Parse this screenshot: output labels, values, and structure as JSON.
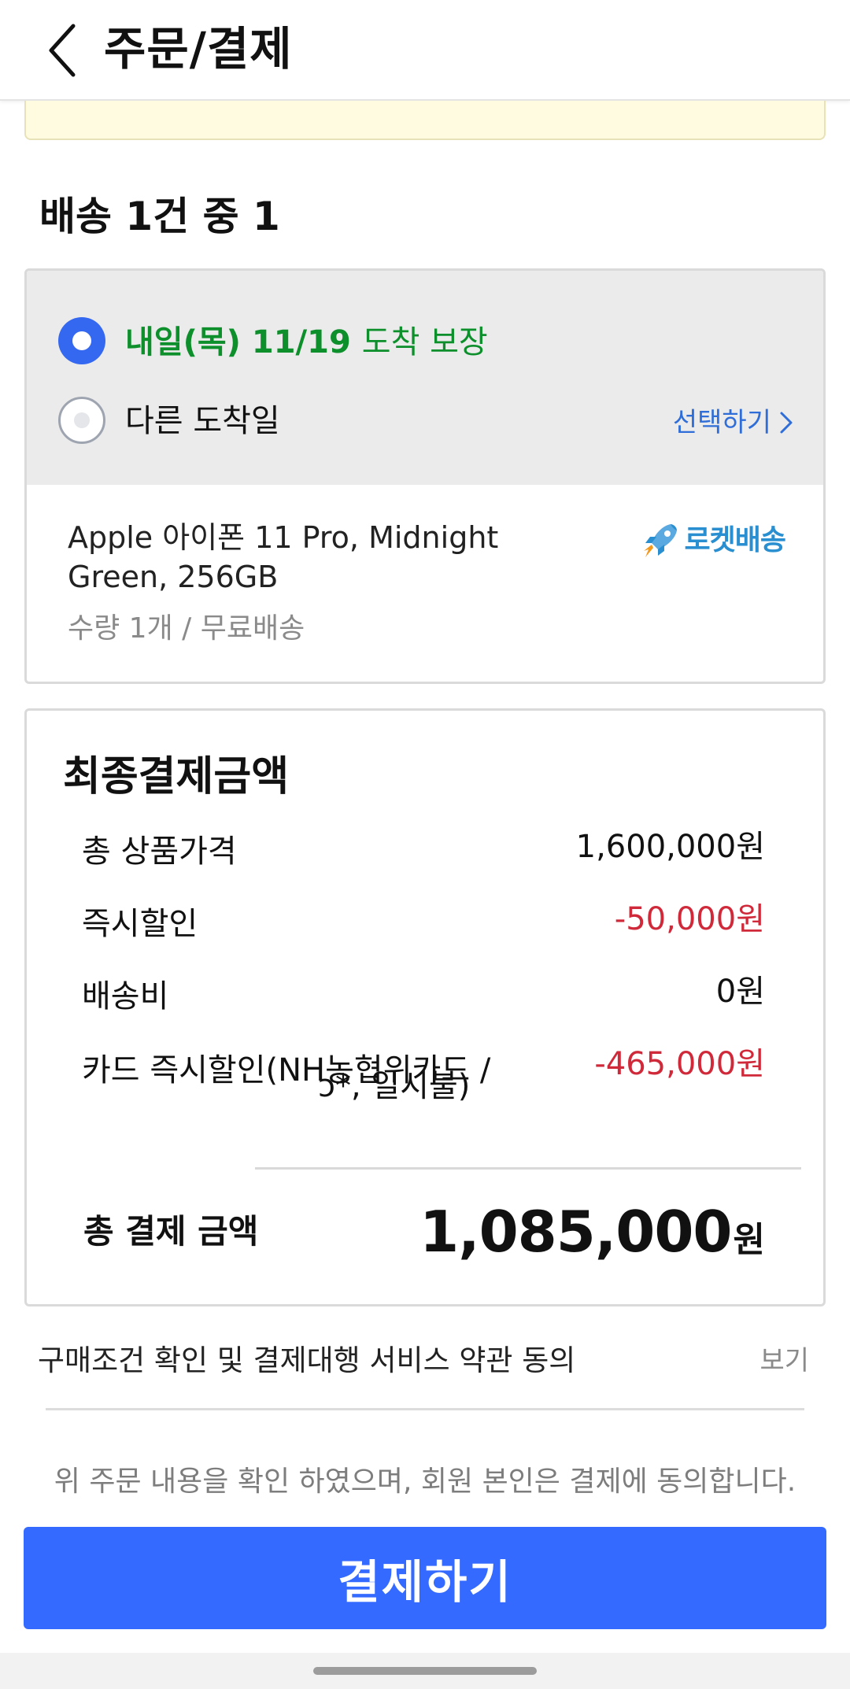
{
  "header": {
    "title": "주문/결제",
    "back_icon": "chevron-left-icon"
  },
  "shipment": {
    "section_title": "배송 1건 중 1",
    "option_selected": {
      "label_bold": "내일(목) 11/19",
      "label_rest": "도착 보장",
      "checked": true,
      "color": "#0d8f2c"
    },
    "option_other": {
      "label": "다른 도착일",
      "checked": false
    },
    "select_link": "선택하기",
    "select_icon": "chevron-right-icon",
    "product": {
      "name": "Apple 아이폰 11 Pro, Midnight Green, 256GB",
      "meta": "수량 1개 / 무료배송",
      "badge_text": "로켓배송",
      "badge_icon": "rocket-icon"
    }
  },
  "payment": {
    "title": "최종결제금액",
    "rows": [
      {
        "label": "총 상품가격",
        "value": "1,600,000원",
        "negative": false
      },
      {
        "label": "즉시할인",
        "value": "-50,000원",
        "negative": true
      },
      {
        "label": "배송비",
        "value": "0원",
        "negative": false
      },
      {
        "label": "카드 즉시할인(NH농협위카드 /",
        "value": "-465,000원",
        "negative": true
      }
    ],
    "card_sub": "ɔ*, 일시불)",
    "total_label": "총 결제 금액",
    "total_value": "1,085,000",
    "total_unit": "원"
  },
  "terms": {
    "text": "구매조건 확인 및 결제대행 서비스 약관 동의",
    "view_label": "보기"
  },
  "consent_text": "위 주문 내용을 확인 하였으며, 회원 본인은 결제에 동의합니다.",
  "pay_button_label": "결제하기",
  "colors": {
    "accent": "#346aff",
    "link": "#2f6dd8",
    "negative": "#d0293a",
    "arrival_green": "#0d8f2c",
    "rocket": "#2a8fd0"
  }
}
